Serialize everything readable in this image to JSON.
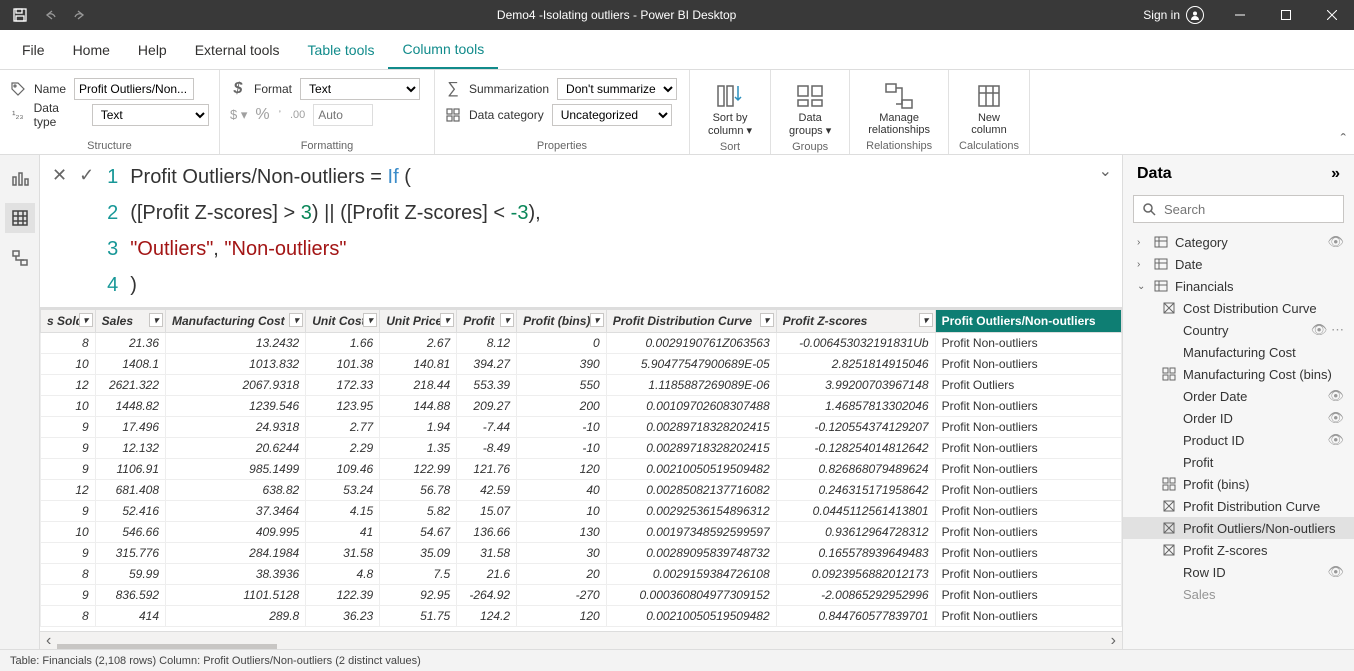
{
  "titlebar": {
    "title": "Demo4 -Isolating outliers - Power BI Desktop",
    "signin": "Sign in"
  },
  "menu": {
    "file": "File",
    "home": "Home",
    "help": "Help",
    "external": "External tools",
    "tabletools": "Table tools",
    "columntools": "Column tools"
  },
  "ribbon": {
    "name_label": "Name",
    "name_value": "Profit Outliers/Non...",
    "datatype_label": "Data type",
    "datatype_value": "Text",
    "format_label": "Format",
    "format_value": "Text",
    "auto_placeholder": "Auto",
    "summ_label": "Summarization",
    "summ_value": "Don't summarize",
    "cat_label": "Data category",
    "cat_value": "Uncategorized",
    "sort_label": "Sort by",
    "sort_label2": "column",
    "groups_label": "Data",
    "groups_label2": "groups",
    "rel_label": "Manage",
    "rel_label2": "relationships",
    "newcol_label": "New",
    "newcol_label2": "column",
    "g_structure": "Structure",
    "g_formatting": "Formatting",
    "g_properties": "Properties",
    "g_sort": "Sort",
    "g_groups": "Groups",
    "g_rel": "Relationships",
    "g_calc": "Calculations"
  },
  "formula": {
    "l1_a": "Profit Outliers/Non-outliers = ",
    "l1_kw": "If",
    "l1_b": " (",
    "l2_a": "    ([Profit Z-scores] > ",
    "l2_n1": "3",
    "l2_b": ") || ([Profit Z-scores] < ",
    "l2_n2": "-3",
    "l2_c": "),",
    "l3_a": "    ",
    "l3_s1": "\"Outliers\"",
    "l3_b": ", ",
    "l3_s2": "\"Non-outliers\"",
    "l4": ")"
  },
  "table": {
    "headers": [
      "s Sold",
      "Sales",
      "Manufacturing Cost",
      "Unit Cost",
      "Unit Price",
      "Profit",
      "Profit (bins)",
      "Profit Distribution Curve",
      "Profit Z-scores",
      "Profit Outliers/Non-outliers"
    ],
    "rows": [
      [
        "8",
        "21.36",
        "13.2432",
        "1.66",
        "2.67",
        "8.12",
        "0",
        "0.0029190761Z063563",
        "-0.006453032191831Ub",
        "Profit Non-outliers"
      ],
      [
        "10",
        "1408.1",
        "1013.832",
        "101.38",
        "140.81",
        "394.27",
        "390",
        "5.90477547900689E-05",
        "2.8251814915046",
        "Profit Non-outliers"
      ],
      [
        "12",
        "2621.322",
        "2067.9318",
        "172.33",
        "218.44",
        "553.39",
        "550",
        "1.1185887269089E-06",
        "3.99200703967148",
        "Profit Outliers"
      ],
      [
        "10",
        "1448.82",
        "1239.546",
        "123.95",
        "144.88",
        "209.27",
        "200",
        "0.00109702608307488",
        "1.46857813302046",
        "Profit Non-outliers"
      ],
      [
        "9",
        "17.496",
        "24.9318",
        "2.77",
        "1.94",
        "-7.44",
        "-10",
        "0.00289718328202415",
        "-0.120554374129207",
        "Profit Non-outliers"
      ],
      [
        "9",
        "12.132",
        "20.6244",
        "2.29",
        "1.35",
        "-8.49",
        "-10",
        "0.00289718328202415",
        "-0.128254014812642",
        "Profit Non-outliers"
      ],
      [
        "9",
        "1106.91",
        "985.1499",
        "109.46",
        "122.99",
        "121.76",
        "120",
        "0.00210050519509482",
        "0.826868079489624",
        "Profit Non-outliers"
      ],
      [
        "12",
        "681.408",
        "638.82",
        "53.24",
        "56.78",
        "42.59",
        "40",
        "0.00285082137716082",
        "0.246315171958642",
        "Profit Non-outliers"
      ],
      [
        "9",
        "52.416",
        "37.3464",
        "4.15",
        "5.82",
        "15.07",
        "10",
        "0.00292536154896312",
        "0.0445112561413801",
        "Profit Non-outliers"
      ],
      [
        "10",
        "546.66",
        "409.995",
        "41",
        "54.67",
        "136.66",
        "130",
        "0.00197348592599597",
        "0.93612964728312",
        "Profit Non-outliers"
      ],
      [
        "9",
        "315.776",
        "284.1984",
        "31.58",
        "35.09",
        "31.58",
        "30",
        "0.00289095839748732",
        "0.165578939649483",
        "Profit Non-outliers"
      ],
      [
        "8",
        "59.99",
        "38.3936",
        "4.8",
        "7.5",
        "21.6",
        "20",
        "0.0029159384726108",
        "0.0923956882012173",
        "Profit Non-outliers"
      ],
      [
        "9",
        "836.592",
        "1101.5128",
        "122.39",
        "92.95",
        "-264.92",
        "-270",
        "0.000360804977309152",
        "-2.00865292952996",
        "Profit Non-outliers"
      ],
      [
        "8",
        "414",
        "289.8",
        "36.23",
        "51.75",
        "124.2",
        "120",
        "0.00210050519509482",
        "0.844760577839701",
        "Profit Non-outliers"
      ]
    ]
  },
  "dataPane": {
    "title": "Data",
    "search_placeholder": "Search",
    "nodes": {
      "category": "Category",
      "date": "Date",
      "financials": "Financials",
      "costDist": "Cost Distribution Curve",
      "country": "Country",
      "mfgCost": "Manufacturing Cost",
      "mfgBins": "Manufacturing Cost (bins)",
      "orderDate": "Order Date",
      "orderId": "Order ID",
      "productId": "Product ID",
      "profit": "Profit",
      "profitBins": "Profit (bins)",
      "profitDist": "Profit Distribution Curve",
      "profitOut": "Profit Outliers/Non-outliers",
      "profitZ": "Profit Z-scores",
      "rowId": "Row ID",
      "sales": "Sales"
    }
  },
  "status": "Table: Financials (2,108 rows) Column: Profit Outliers/Non-outliers (2 distinct values)"
}
